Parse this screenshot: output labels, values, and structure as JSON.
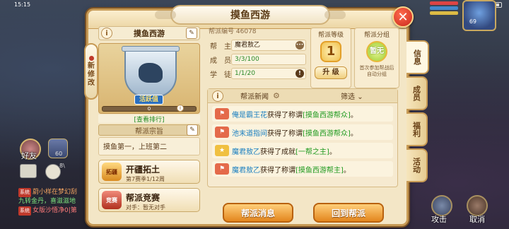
{
  "status": {
    "time": "15:15"
  },
  "hud": {
    "friend_label": "好友",
    "avatar2_label": "60",
    "mic_count": "8\\",
    "hero_level": "69",
    "attack_label": "攻击",
    "cancel_label": "取消",
    "chat": [
      {
        "tag": "系统",
        "text": "蔚小样在梦幻刮",
        "cls": "chat-1"
      },
      {
        "tag": "",
        "text": "九转金丹，喜滋滋地",
        "cls": "chat-2"
      },
      {
        "tag": "系统",
        "text": "女版沙悟净0|第",
        "cls": "chat-3"
      }
    ]
  },
  "panel": {
    "title": "摸鱼西游",
    "close_symbol": "✕",
    "new_tag": [
      "新",
      "修",
      "改"
    ]
  },
  "guild": {
    "name": "摸鱼西游",
    "activity_label": "活跃值",
    "activity_value": "0",
    "activity_fill": 0,
    "ranking_link": "[查看排行]",
    "creed_header": "帮派宗旨",
    "creed_text": "摸鱼第一，上班第二",
    "id_label": "帮派编号",
    "id_value": "46078",
    "rows": [
      {
        "label": "帮　主",
        "value": "魔君敖乙"
      },
      {
        "label": "成　员",
        "value": "3/3/100"
      },
      {
        "label": "学　徒",
        "value": "1/1/20"
      }
    ]
  },
  "features": [
    {
      "icon": "拓疆",
      "title": "开疆拓土",
      "sub": "第7赛季1/12周"
    },
    {
      "icon": "竞赛",
      "title": "帮派竞赛",
      "sub": "对手：暂无对手"
    }
  ],
  "level_box": {
    "title": "帮派等级",
    "level": "1",
    "upgrade_label": "升 级"
  },
  "group_box": {
    "title": "帮派分组",
    "badge": "暂无",
    "note_line1": "首次参加帮战后",
    "note_line2": "自动分组"
  },
  "news": {
    "title": "帮派新闻",
    "filter_label": "筛选",
    "items": [
      {
        "icon": "flag",
        "name": "俺是霸王花",
        "mid": "获得了称谓",
        "highlight": "[摸鱼西游帮众]",
        "end": "。"
      },
      {
        "icon": "flag",
        "name": "池末道指间",
        "mid": "获得了称谓",
        "highlight": "[摸鱼西游帮众]",
        "end": "。"
      },
      {
        "icon": "star",
        "name": "魔君敖乙",
        "mid": "获得了成就",
        "highlight": "[一帮之主]",
        "end": "。"
      },
      {
        "icon": "flag",
        "name": "魔君敖乙",
        "mid": "获得了称谓",
        "highlight": "[摸鱼西游帮主]",
        "end": "。"
      }
    ]
  },
  "buttons": {
    "message": "帮派消息",
    "return": "回到帮派"
  },
  "tabs": [
    "信息",
    "成员",
    "福利",
    "活动"
  ]
}
